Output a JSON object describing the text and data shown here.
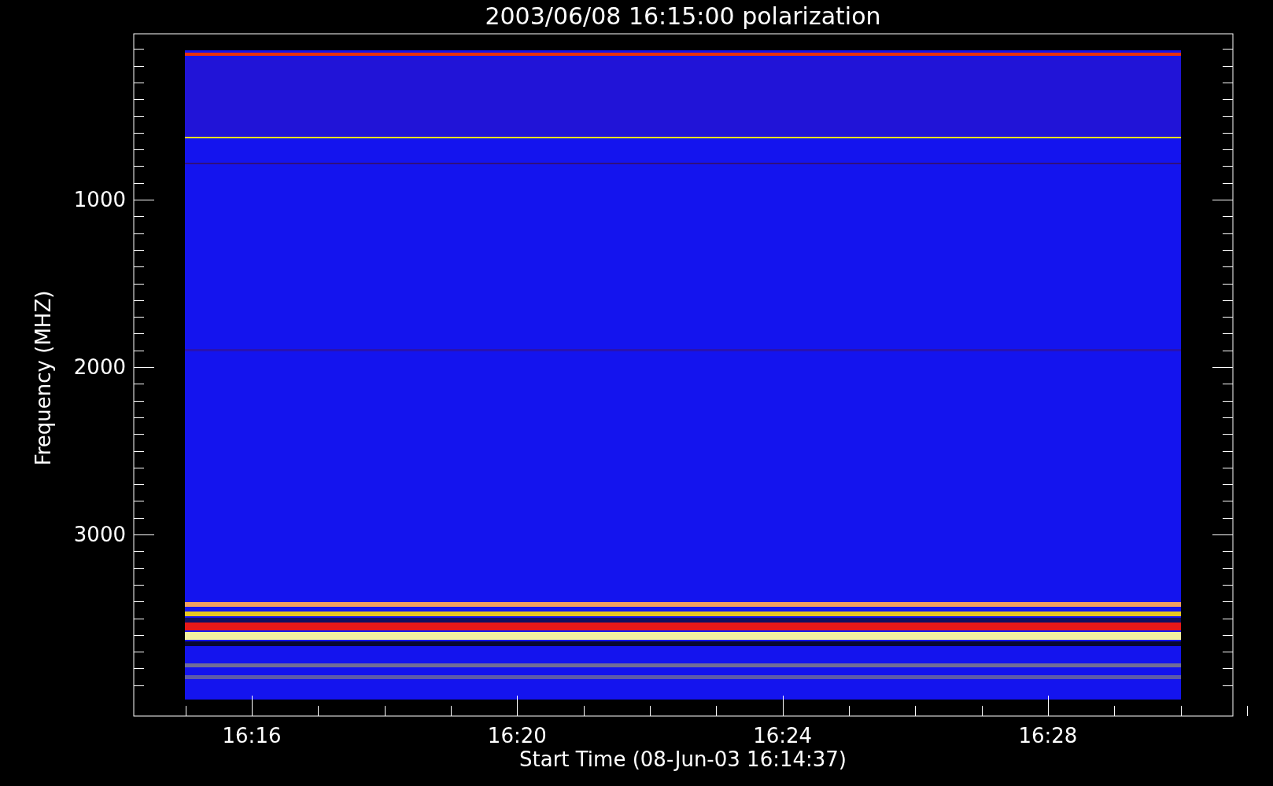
{
  "plot": {
    "title": "2003/06/08 16:15:00 polarization",
    "xlabel": "Start Time (08-Jun-03 16:14:37)",
    "ylabel": "Frequency (MHZ)",
    "y_tick_labels": [
      "1000",
      "2000",
      "3000"
    ],
    "x_tick_labels": [
      "16:16",
      "16:20",
      "16:24",
      "16:28"
    ]
  }
}
